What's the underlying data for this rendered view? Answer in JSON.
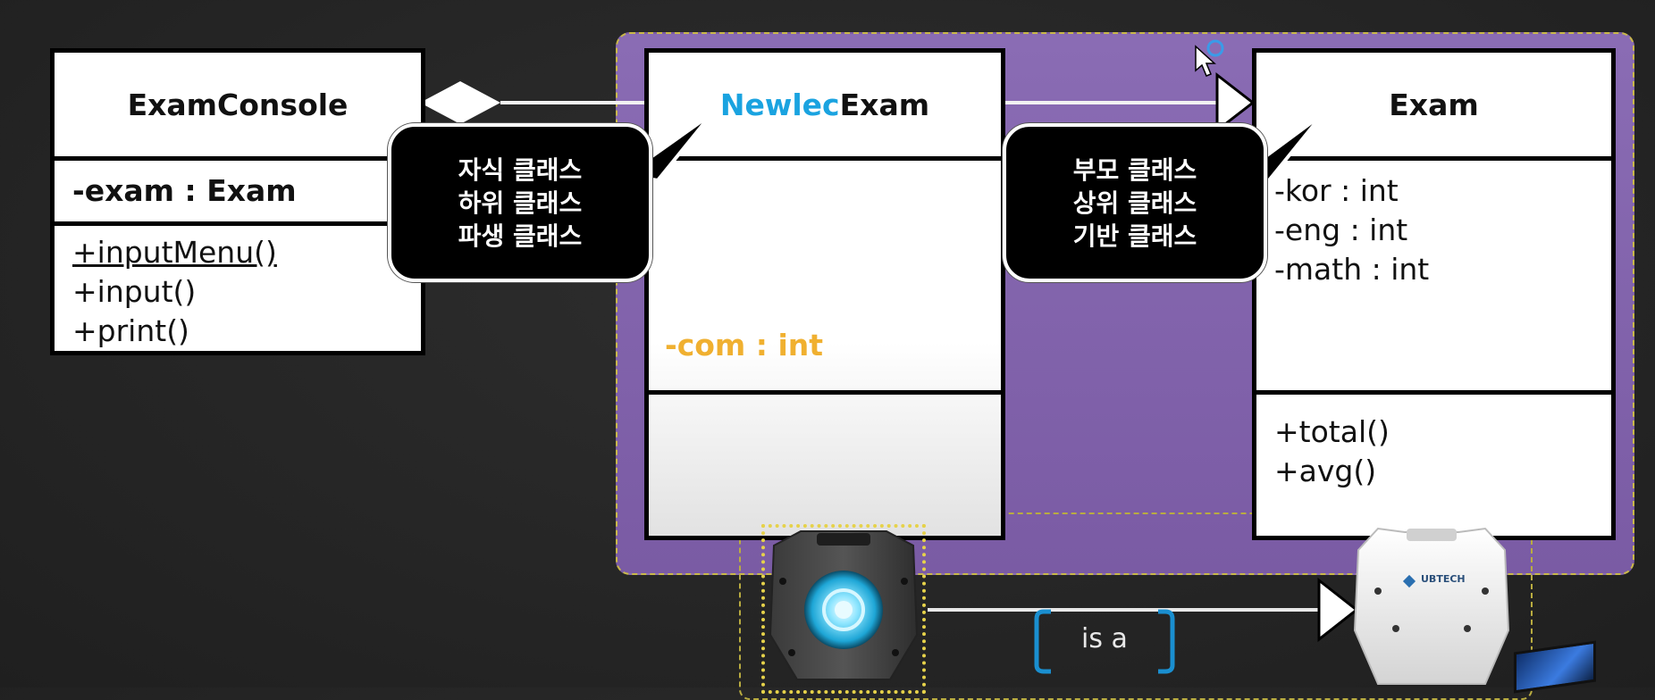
{
  "exam_console": {
    "title": "ExamConsole",
    "attribute": "-exam : Exam",
    "methods": [
      "+inputMenu()",
      "+input()",
      "+print()"
    ]
  },
  "newlec_exam": {
    "title_prefix": "Newlec",
    "title_suffix": "Exam",
    "attribute": "-com : int"
  },
  "exam": {
    "title": "Exam",
    "attributes": [
      "-kor : int",
      "-eng : int",
      "-math : int"
    ],
    "methods": [
      "+total()",
      "+avg()"
    ]
  },
  "callouts": {
    "child": [
      "자식 클래스",
      "하위 클래스",
      "파생 클래스"
    ],
    "parent": [
      "부모 클래스",
      "상위 클래스",
      "기반 클래스"
    ]
  },
  "relation_label": "is a",
  "robot_logo_text": "UBTECH",
  "colors": {
    "panel": "#8a6cb4",
    "highlight_blue": "#1aa3e0",
    "highlight_orange": "#f0b030"
  }
}
